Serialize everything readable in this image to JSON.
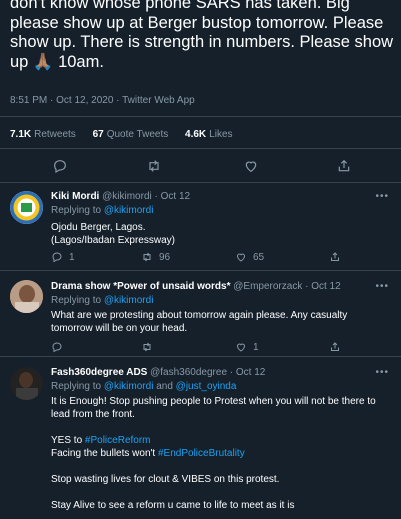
{
  "main_tweet": {
    "text": "don't know whose phone SARS has taken. Big please show up at Berger bustop tomorrow. Please show up. There is strength in numbers. Please show up 🙏🏽 10am.",
    "meta": "8:51 PM · Oct 12, 2020 · Twitter Web App",
    "retweets_count": "7.1K",
    "retweets_label": "Retweets",
    "quotes_count": "67",
    "quotes_label": "Quote Tweets",
    "likes_count": "4.6K",
    "likes_label": "Likes"
  },
  "replies": [
    {
      "name": "Kiki Mordi",
      "handle": "@kikimordi",
      "time": "· Oct 12",
      "replying_prefix": "Replying to",
      "replying_to": "@kikimordi",
      "lines": [
        "Ojodu Berger, Lagos.",
        "(Lagos/Ibadan Expressway)"
      ],
      "reply_count": "1",
      "retweet_count": "96",
      "like_count": "65"
    },
    {
      "name": "Drama show *Power of unsaid words*",
      "handle": "@Emperorzack",
      "time": "· Oct 12",
      "replying_prefix": "Replying to",
      "replying_to": "@kikimordi",
      "lines": [
        "What are we protesting about tomorrow again please. Any casualty tomorrow will be on your head."
      ],
      "reply_count": "",
      "retweet_count": "",
      "like_count": "1"
    },
    {
      "name": "Fash360degree ADS",
      "handle": "@fash360degree",
      "time": "· Oct 12",
      "replying_prefix": "Replying to",
      "replying_to": "@kikimordi",
      "replying_and": "and",
      "replying_to2": "@just_oyinda",
      "line1": "It is Enough! Stop pushing people to Protest when you will not be there to lead from the front.",
      "yes_to": "YES to",
      "hashtag1": "#PoliceReform",
      "facing": "Facing the bullets won't",
      "hashtag2": "#EndPoliceBrutality",
      "line4": "Stop wasting lives for clout & VIBES on this protest.",
      "line5": "Stay Alive to see a reform u came to life to meet as it is"
    }
  ],
  "more_label": "•••",
  "colors": {
    "background": "#15202b",
    "accent": "#1da1f2",
    "secondary_text": "#8899a6",
    "divider": "#38444d"
  },
  "icons": [
    "reply-icon",
    "retweet-icon",
    "like-icon",
    "share-icon"
  ]
}
